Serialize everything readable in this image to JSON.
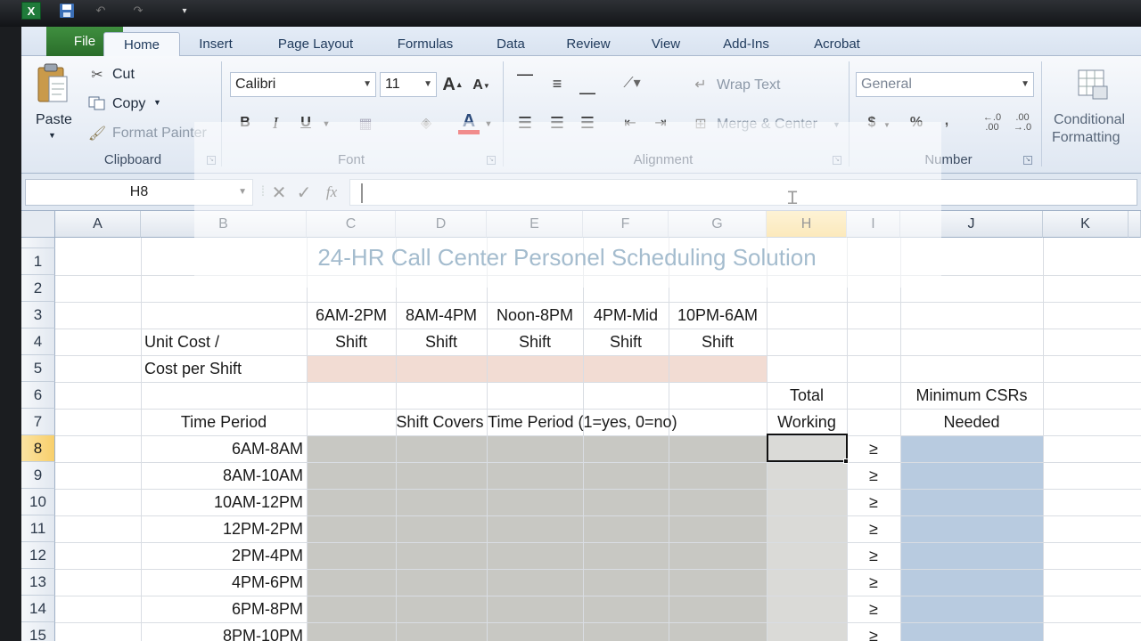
{
  "window": {
    "quick_access": {
      "app_icon_letter": "X",
      "icons": [
        "excel-icon",
        "save-icon",
        "undo-icon",
        "redo-icon",
        "customize-dropdown-icon"
      ]
    }
  },
  "ribbon": {
    "tabs": [
      "File",
      "Home",
      "Insert",
      "Page Layout",
      "Formulas",
      "Data",
      "Review",
      "View",
      "Add-Ins",
      "Acrobat"
    ],
    "active_tab": "Home",
    "clipboard": {
      "paste": "Paste",
      "cut": "Cut",
      "copy": "Copy",
      "format_painter": "Format Painter",
      "label": "Clipboard"
    },
    "font": {
      "family": "Calibri",
      "size": "11",
      "bold": "B",
      "italic": "I",
      "underline": "U",
      "font_color_letter": "A",
      "label": "Font"
    },
    "alignment": {
      "wrap_text": "Wrap Text",
      "merge_center": "Merge & Center",
      "label": "Alignment"
    },
    "number": {
      "format": "General",
      "currency": "$",
      "percent": "%",
      "comma": ",",
      "increase_decimal": "←.0 .00",
      "decrease_decimal": ".00 →.0",
      "label": "Number"
    },
    "styles": {
      "conditional_line1": "Conditional",
      "conditional_line2": "Formatting"
    },
    "colors": {
      "file_tab": "#2f7d32",
      "font_color_bar": "#e00000"
    }
  },
  "formula_bar": {
    "name_box": "H8",
    "cancel": "✕",
    "enter": "✓",
    "fx": "fx",
    "value": ""
  },
  "grid": {
    "columns": [
      "A",
      "B",
      "C",
      "D",
      "E",
      "F",
      "G",
      "H",
      "I",
      "J",
      "K"
    ],
    "selected_column": "H",
    "rows": [
      "1",
      "2",
      "3",
      "4",
      "5",
      "6",
      "7",
      "8",
      "9",
      "10",
      "11",
      "12",
      "13",
      "14",
      "15"
    ],
    "selected_row": "8",
    "title": "24-HR Call Center Personel Scheduling Solution",
    "shift_names": [
      "6AM-2PM",
      "8AM-4PM",
      "Noon-8PM",
      "4PM-Mid",
      "10PM-6AM"
    ],
    "shift_word": "Shift",
    "unit_cost_label": "Unit Cost /",
    "cost_per_shift_label": "Cost per Shift",
    "total_label": "Total",
    "working_label": "Working",
    "min_csrs_label": "Minimum CSRs",
    "needed_label": "Needed",
    "time_period_label": "Time Period",
    "shift_covers_label": "Shift Covers Time Period (1=yes, 0=no)",
    "time_periods": [
      "6AM-8AM",
      "8AM-10AM",
      "10AM-12PM",
      "12PM-2PM",
      "2PM-4PM",
      "4PM-6PM",
      "6PM-8PM",
      "8PM-10PM"
    ],
    "gte_symbol": "≥",
    "fill_colors": {
      "cost_row": "#f2dcd3",
      "coverage": "#c8c8c3",
      "total_col": "#dadad7",
      "min_col": "#b8cbe0",
      "title_text": "#366a93"
    }
  }
}
